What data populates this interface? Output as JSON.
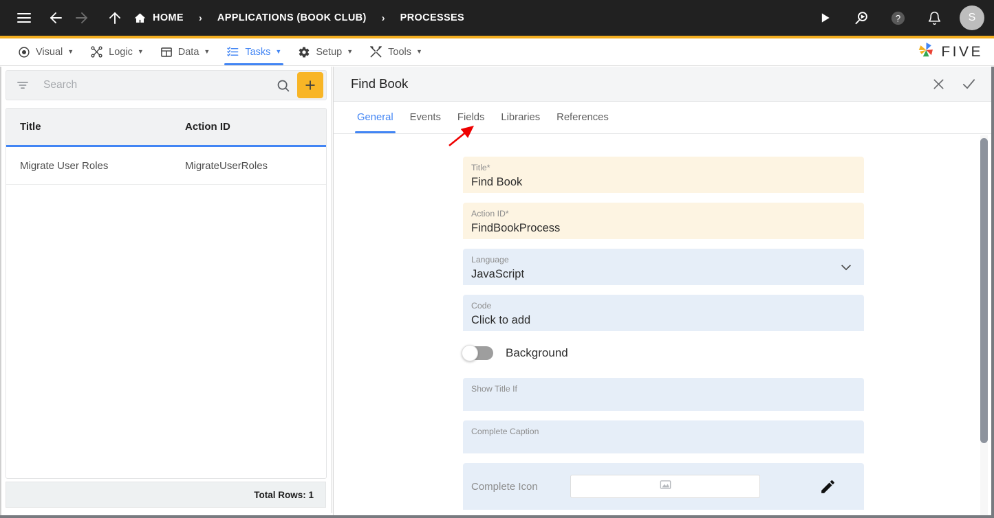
{
  "topbar": {
    "menu_icon": "hamburger-icon",
    "back_icon": "arrow-left-icon",
    "forward_icon": "arrow-right-icon",
    "up_icon": "arrow-up-icon",
    "breadcrumbs": [
      {
        "label": "HOME",
        "icon": "home-icon"
      },
      {
        "label": "APPLICATIONS (BOOK CLUB)",
        "icon": ""
      },
      {
        "label": "PROCESSES",
        "icon": ""
      }
    ],
    "separator": "›",
    "actions": [
      {
        "name": "run-icon",
        "label": "Run"
      },
      {
        "name": "search-run-icon",
        "label": "Search & Run"
      },
      {
        "name": "help-icon",
        "label": "Help"
      },
      {
        "name": "notifications-bell-icon",
        "label": "Notifications"
      }
    ],
    "avatar_initial": "S"
  },
  "menubar": {
    "items": [
      {
        "label": "Visual",
        "icon": "eye-icon",
        "caret": "▼",
        "active": false
      },
      {
        "label": "Logic",
        "icon": "logic-nodes-icon",
        "caret": "▼",
        "active": false
      },
      {
        "label": "Data",
        "icon": "table-grid-icon",
        "caret": "▼",
        "active": false
      },
      {
        "label": "Tasks",
        "icon": "tasks-list-icon",
        "caret": "▼",
        "active": true
      },
      {
        "label": "Setup",
        "icon": "gear-icon",
        "caret": "▼",
        "active": false
      },
      {
        "label": "Tools",
        "icon": "tools-wrench-icon",
        "caret": "▼",
        "active": false
      }
    ],
    "brand": "FIVE"
  },
  "sidebar": {
    "search": {
      "placeholder": "Search",
      "value": "",
      "filter_icon": "filter-icon",
      "search_icon": "search-icon",
      "add_label": "+"
    },
    "table": {
      "columns": [
        "Title",
        "Action ID"
      ],
      "rows": [
        {
          "title": "Migrate User Roles",
          "action_id": "MigrateUserRoles"
        }
      ]
    },
    "footer": {
      "total_rows": "Total Rows: 1"
    }
  },
  "panel": {
    "title": "Find Book",
    "close_icon": "close-icon",
    "confirm_icon": "check-icon",
    "tabs": [
      {
        "label": "General",
        "active": true
      },
      {
        "label": "Events",
        "active": false
      },
      {
        "label": "Fields",
        "active": false
      },
      {
        "label": "Libraries",
        "active": false
      },
      {
        "label": "References",
        "active": false
      }
    ],
    "form": {
      "title_field": {
        "label": "Title",
        "required": "*",
        "value": "Find Book"
      },
      "action_id_field": {
        "label": "Action ID",
        "required": "*",
        "value": "FindBookProcess"
      },
      "language_field": {
        "label": "Language",
        "value": "JavaScript",
        "chevron": "chevron-down-icon"
      },
      "code_field": {
        "label": "Code",
        "value": "Click to add"
      },
      "background_toggle": {
        "label": "Background",
        "state": "off"
      },
      "show_title_if_field": {
        "label": "Show Title If",
        "value": ""
      },
      "complete_caption_field": {
        "label": "Complete Caption",
        "value": ""
      },
      "complete_icon_field": {
        "label": "Complete Icon",
        "image_placeholder": "image-icon",
        "edit_icon": "pencil-icon"
      }
    }
  },
  "annotation": {
    "type": "arrow",
    "color": "#ee0000",
    "points_to": "Fields"
  },
  "colors": {
    "topbar_bg": "#212121",
    "accent": "#f2ad1f",
    "active_blue": "#4285f4",
    "required_field_bg": "#fdf4e2",
    "normal_field_bg": "#e6eef8",
    "add_button": "#f8b526"
  }
}
